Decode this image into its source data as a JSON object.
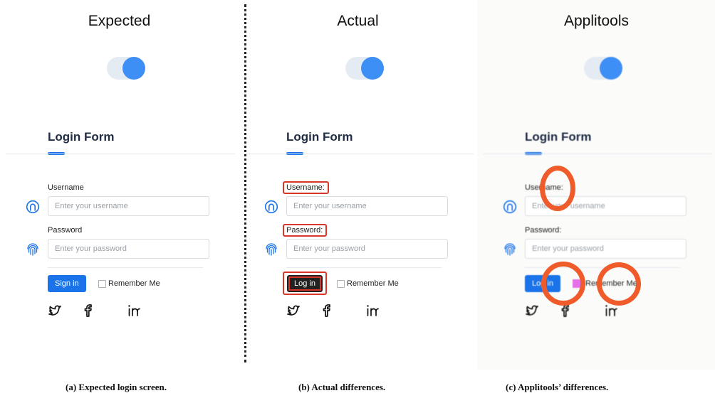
{
  "columns": [
    {
      "heading": "Expected",
      "caption": "(a)  Expected login screen."
    },
    {
      "heading": "Actual",
      "caption": "(b)  Actual differences."
    },
    {
      "heading": "Applitools",
      "caption": "(c)  Applitools’ differences."
    }
  ],
  "form": {
    "title": "Login Form",
    "username_label": "Username",
    "password_label": "Password",
    "username_placeholder": "Enter your username",
    "password_placeholder": "Enter your password",
    "signin_label": "Sign in",
    "remember_label": "Remember Me"
  },
  "actual_form": {
    "username_label": "Username:",
    "password_label": "Password:",
    "login_label": "Log in",
    "remember_label": "Remember Me"
  },
  "applitools_form": {
    "username_label": "Username:",
    "password_label": "Password:",
    "login_label": "Log in",
    "remember_label": "Remember Me"
  },
  "icons": {
    "user": "user-circle-icon",
    "password": "fingerprint-icon",
    "twitter": "twitter-icon",
    "facebook": "facebook-icon",
    "linkedin": "linkedin-icon"
  },
  "colors": {
    "accent": "#1a73e8",
    "toggle_knob": "#3e8ff5",
    "difference_box": "#d9362b",
    "difference_ring": "#ef5b2a",
    "dark_button": "#222222"
  }
}
